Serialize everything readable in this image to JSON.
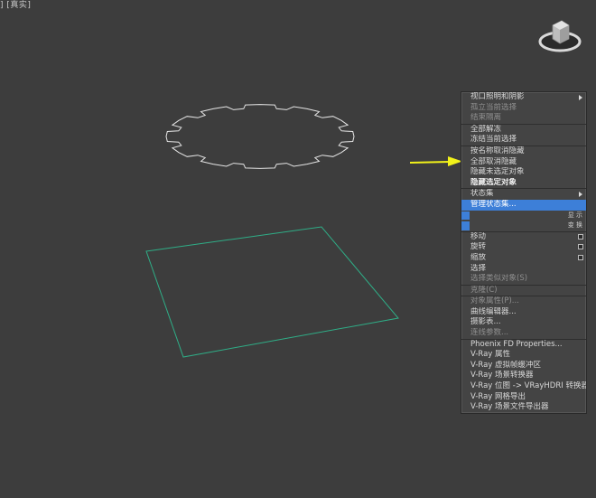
{
  "viewport": {
    "label": "] [真实]"
  },
  "menu": {
    "items": [
      {
        "label": "视口照明和阴影",
        "style": "normal",
        "submenu": true
      },
      {
        "label": "孤立当前选择",
        "style": "dim"
      },
      {
        "label": "结束隔离",
        "style": "dim"
      },
      {
        "sep": true
      },
      {
        "label": "全部解冻",
        "style": "normal"
      },
      {
        "label": "冻结当前选择",
        "style": "normal"
      },
      {
        "sep": true
      },
      {
        "label": "按名称取消隐藏",
        "style": "normal"
      },
      {
        "label": "全部取消隐藏",
        "style": "normal"
      },
      {
        "label": "隐藏未选定对象",
        "style": "normal"
      },
      {
        "label": "隐藏选定对象",
        "style": "bold"
      },
      {
        "sep": true
      },
      {
        "label": "状态集",
        "style": "normal",
        "submenu": true
      },
      {
        "label": "管理状态集...",
        "style": "hl"
      },
      {
        "label": "",
        "style": "stub",
        "right": "显 示"
      },
      {
        "label": "",
        "style": "stub",
        "right": "变 换"
      },
      {
        "sep": true
      },
      {
        "label": "移动",
        "style": "normal",
        "box": true
      },
      {
        "label": "旋转",
        "style": "normal",
        "box": true
      },
      {
        "label": "缩放",
        "style": "normal",
        "box": true
      },
      {
        "label": "选择",
        "style": "normal"
      },
      {
        "label": "选择类似对象(S)",
        "style": "dim"
      },
      {
        "sep": true
      },
      {
        "label": "克隆(C)",
        "style": "dim"
      },
      {
        "sep": true
      },
      {
        "label": "对象属性(P)...",
        "style": "dim"
      },
      {
        "label": "曲线编辑器...",
        "style": "normal"
      },
      {
        "label": "摄影表...",
        "style": "normal"
      },
      {
        "label": "连线参数...",
        "style": "dim"
      },
      {
        "sep": true
      },
      {
        "label": "Phoenix FD Properties...",
        "style": "normal"
      },
      {
        "label": "V-Ray 属性",
        "style": "normal"
      },
      {
        "label": "V-Ray 虚拟帧缓冲区",
        "style": "normal"
      },
      {
        "label": "V-Ray 场景转换器",
        "style": "normal"
      },
      {
        "label": "V-Ray 位图 -> VRayHDRI 转换器",
        "style": "normal"
      },
      {
        "label": "V-Ray 网格导出",
        "style": "normal"
      },
      {
        "label": "V-Ray 场景文件导出器",
        "style": "normal"
      }
    ]
  },
  "colors": {
    "background": "#3d3d3d",
    "gear_outline": "#e6e6e6",
    "plane_outline": "#2fae87",
    "arrow": "#f2f21a",
    "highlight": "#3d7fd8"
  },
  "icons": {
    "viewcube": "viewcube-icon",
    "arrow": "arrow-right-icon"
  }
}
